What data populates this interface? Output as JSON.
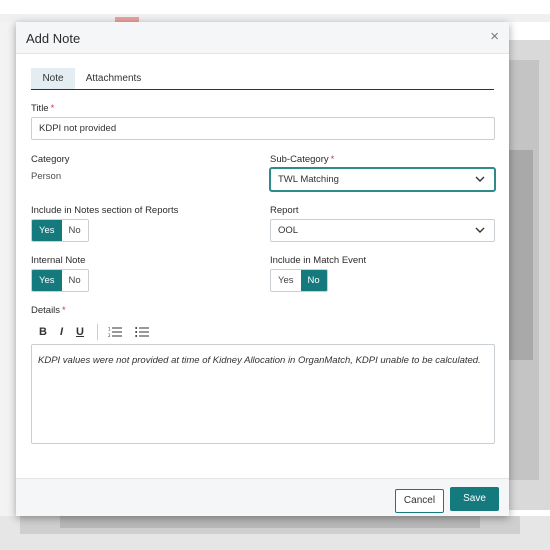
{
  "modal": {
    "title": "Add Note",
    "close_symbol": "×"
  },
  "tabs": [
    {
      "label": "Note",
      "active": true
    },
    {
      "label": "Attachments",
      "active": false
    }
  ],
  "title_field": {
    "label": "Title",
    "required_mark": "*",
    "value": "KDPI not provided"
  },
  "category": {
    "label": "Category",
    "value": "Person"
  },
  "sub_category": {
    "label": "Sub-Category",
    "required_mark": "*",
    "value": "TWL Matching"
  },
  "include_notes": {
    "label": "Include in Notes section of Reports",
    "yes": "Yes",
    "no": "No",
    "selected": "Yes"
  },
  "report": {
    "label": "Report",
    "value": "OOL"
  },
  "internal_note": {
    "label": "Internal Note",
    "yes": "Yes",
    "no": "No",
    "selected": "Yes"
  },
  "include_match": {
    "label": "Include in Match Event",
    "yes": "Yes",
    "no": "No",
    "selected": "No"
  },
  "details": {
    "label": "Details",
    "required_mark": "*",
    "toolbar": {
      "bold": "B",
      "italic": "I",
      "underline": "U",
      "ordered_list_icon": "ordered-list-icon",
      "bullet_list_icon": "bullet-list-icon"
    },
    "text": "KDPI values were not provided at time of Kidney Allocation in OrganMatch, KDPI unable to be calculated."
  },
  "footer": {
    "cancel": "Cancel",
    "save": "Save"
  },
  "colors": {
    "accent": "#157a7e",
    "required": "#d9333f",
    "header_bg": "#f4f6f7"
  }
}
